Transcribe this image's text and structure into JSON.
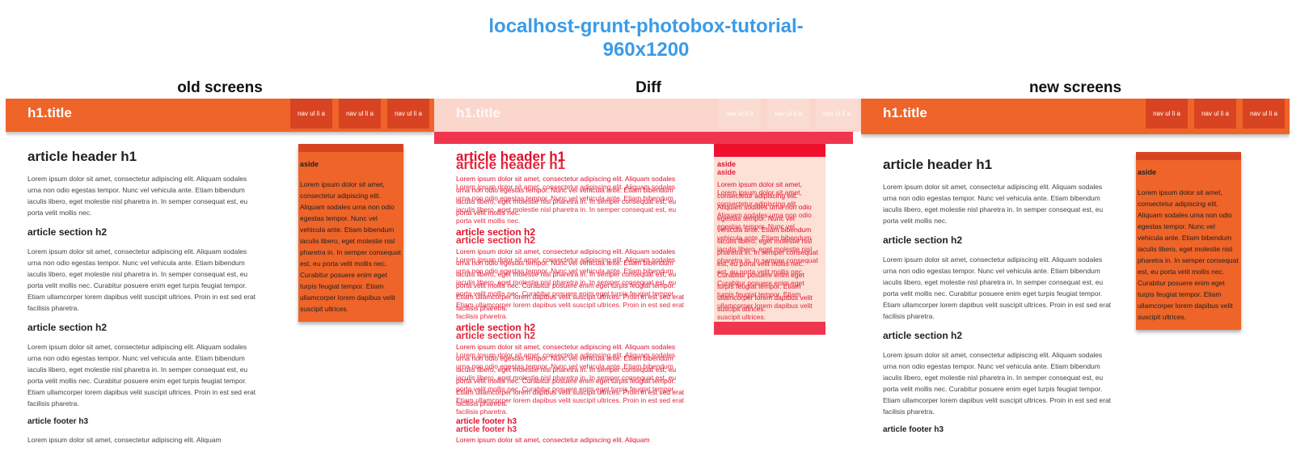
{
  "report": {
    "title_line1": "localhost-grunt-photobox-tutorial-",
    "title_line2": "960x1200"
  },
  "columns": {
    "old": "old screens",
    "diff": "Diff",
    "new": "new screens"
  },
  "site": {
    "title": "h1.title",
    "nav": [
      "nav ul li a",
      "nav ul li a",
      "nav ul li a"
    ],
    "article_header": "article header h1",
    "para1": "Lorem ipsum dolor sit amet, consectetur adipiscing elit. Aliquam sodales urna non odio egestas tempor. Nunc vel vehicula ante. Etiam bibendum iaculis libero, eget molestie nisl pharetra in. In semper consequat est, eu porta velit mollis nec.",
    "section_title": "article section h2",
    "para2": "Lorem ipsum dolor sit amet, consectetur adipiscing elit. Aliquam sodales urna non odio egestas tempor. Nunc vel vehicula ante. Etiam bibendum iaculis libero, eget molestie nisl pharetra in. In semper consequat est, eu porta velit mollis nec. Curabitur posuere enim eget turpis feugiat tempor. Etiam ullamcorper lorem dapibus velit suscipit ultrices. Proin in est sed erat facilisis pharetra.",
    "footer_title": "article footer h3",
    "footer_text": "Lorem ipsum dolor sit amet, consectetur adipiscing elit. Aliquam",
    "aside_title": "aside",
    "aside_text": "Lorem ipsum dolor sit amet, consectetur adipiscing elit. Aliquam sodales urna non odio egestas tempor. Nunc vel vehicula ante. Etiam bibendum iaculis libero, eget molestie nisl pharetra in. In semper consequat est, eu porta velit mollis nec. Curabitur posuere enim eget turpis feugiat tempor. Etiam ullamcorper lorem dapibus velit suscipit ultrices."
  },
  "colors": {
    "title_blue": "#3a9be8",
    "header_orange": "#ef6428",
    "nav_dark": "#d84422",
    "diff_red": "#e0102a"
  }
}
